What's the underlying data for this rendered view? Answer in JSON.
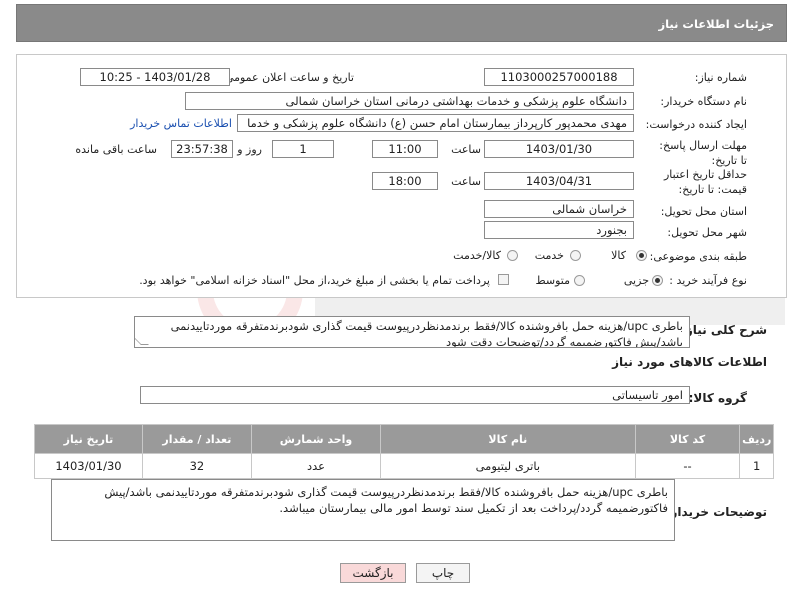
{
  "header": {
    "title": "جزئیات اطلاعات نیاز"
  },
  "form": {
    "need_number": {
      "label": "شماره نیاز:",
      "value": "1103000257000188"
    },
    "announce_datetime": {
      "label": "تاریخ و ساعت اعلان عمومی:",
      "value": "1403/01/28 - 10:25"
    },
    "buyer_org": {
      "label": "نام دستگاه خریدار:",
      "value": "دانشگاه علوم پزشکی و خدمات بهداشتی درمانی استان خراسان شمالی"
    },
    "requester": {
      "label": "ایجاد کننده درخواست:",
      "value": "مهدی محمدپور کارپرداز بیمارستان امام حسن (ع) دانشگاه علوم پزشکی و خدما",
      "contact_link": "اطلاعات تماس خریدار"
    },
    "reply_deadline": {
      "label": "مهلت ارسال پاسخ: تا تاریخ:",
      "date": "1403/01/30",
      "time_label": "ساعت",
      "time": "11:00",
      "days": "1",
      "days_label": "روز و",
      "remaining": "23:57:38",
      "remaining_label": "ساعت باقی مانده"
    },
    "price_validity": {
      "label": "حداقل تاریخ اعتبار قیمت: تا تاریخ:",
      "date": "1403/04/31",
      "time_label": "ساعت",
      "time": "18:00"
    },
    "delivery_province": {
      "label": "استان محل تحویل:",
      "value": "خراسان شمالی"
    },
    "delivery_city": {
      "label": "شهر محل تحویل:",
      "value": "بجنورد"
    },
    "category": {
      "label": "طبقه بندی موضوعی:",
      "options": [
        "کالا",
        "خدمت",
        "کالا/خدمت"
      ],
      "selected": "کالا"
    },
    "purchase_type": {
      "label": "نوع فرآیند خرید :",
      "options": [
        "جزیی",
        "متوسط"
      ],
      "selected": "جزیی",
      "note": "پرداخت تمام یا بخشی از مبلغ خرید،از محل \"اسناد خزانه اسلامی\" خواهد بود."
    }
  },
  "description": {
    "label": "شرح کلی نیاز:",
    "text": "باطری upc/هزینه حمل بافروشنده کالا/فقط برندمدنظردرپیوست قیمت گذاری شودبرندمتفرقه موردتاییدنمی باشد/پیش فاکتورضمیمه گردد/توضیحات دقت شود"
  },
  "goods_section": {
    "title": "اطلاعات کالاهای مورد نیاز",
    "group_label": "گروه کالا:",
    "group_value": "امور تاسیساتی"
  },
  "table": {
    "headers": [
      "ردیف",
      "کد کالا",
      "نام کالا",
      "واحد شمارش",
      "تعداد / مقدار",
      "تاریخ نیاز"
    ],
    "rows": [
      [
        "1",
        "--",
        "باتری لیتیومی",
        "عدد",
        "32",
        "1403/01/30"
      ]
    ]
  },
  "buyer_notes": {
    "label": "توضیحات خریدار:",
    "text": "باطری upc/هزینه حمل بافروشنده کالا/فقط برندمدنظردرپیوست قیمت گذاری شودبرندمتفرقه موردتاییدنمی باشد/پیش فاکتورضمیمه گردد/پرداخت بعد از تکمیل سند توسط امور مالی بیمارستان میباشد."
  },
  "buttons": {
    "print": "چاپ",
    "back": "بازگشت"
  },
  "colors": {
    "header_bg": "#8a8a8a",
    "back_button_bg": "#f9d9d9",
    "link": "#1a4fb0"
  }
}
